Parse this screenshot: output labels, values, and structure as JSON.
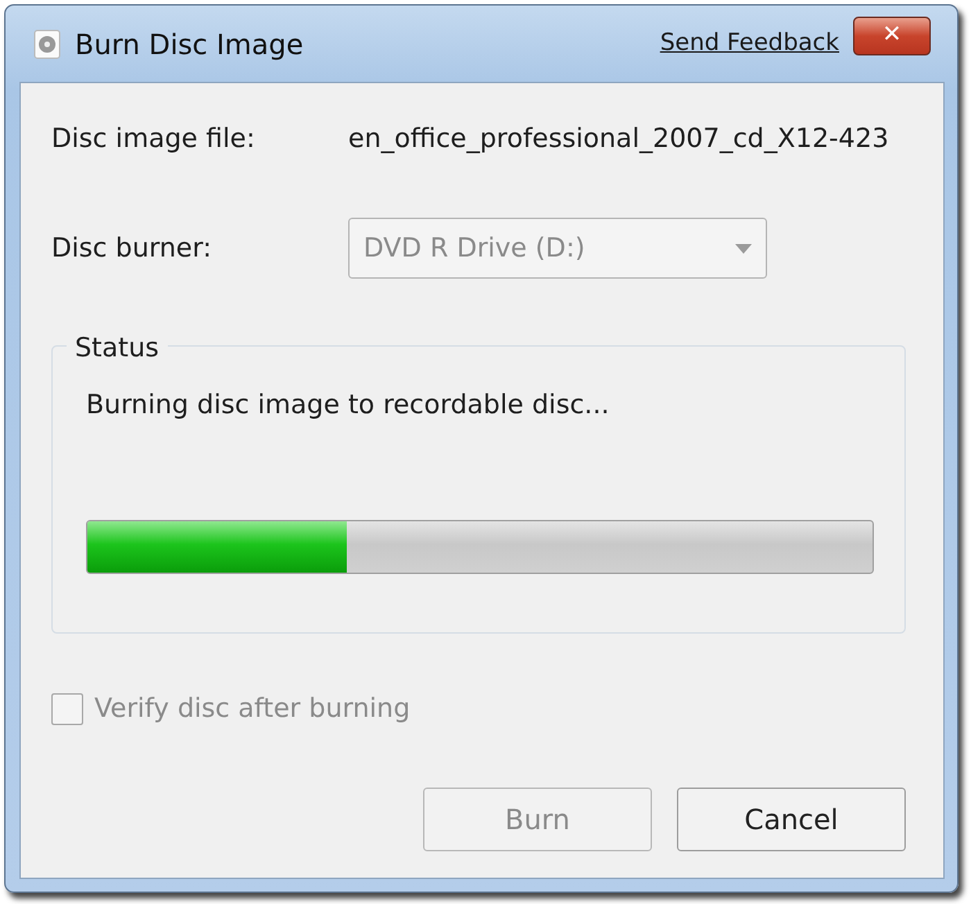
{
  "window": {
    "title": "Burn Disc Image",
    "feedback_link": "Send Feedback",
    "close_label": "✕"
  },
  "fields": [
    {
      "kind": "text",
      "label": "Disc image file:",
      "value": "en_office_professional_2007_cd_X12-423"
    },
    {
      "kind": "dropdown",
      "label": "Disc burner:",
      "value": "DVD R Drive (D:)",
      "disabled": true
    }
  ],
  "status": {
    "title": "Status",
    "message": "Burning disc image to recordable disc...",
    "level": 0.33
  },
  "verify": {
    "label": "Verify disc after burning",
    "checked": false,
    "disabled": true
  },
  "buttons": [
    {
      "label": "Burn",
      "disabled": true
    },
    {
      "label": "Cancel",
      "disabled": false
    }
  ]
}
